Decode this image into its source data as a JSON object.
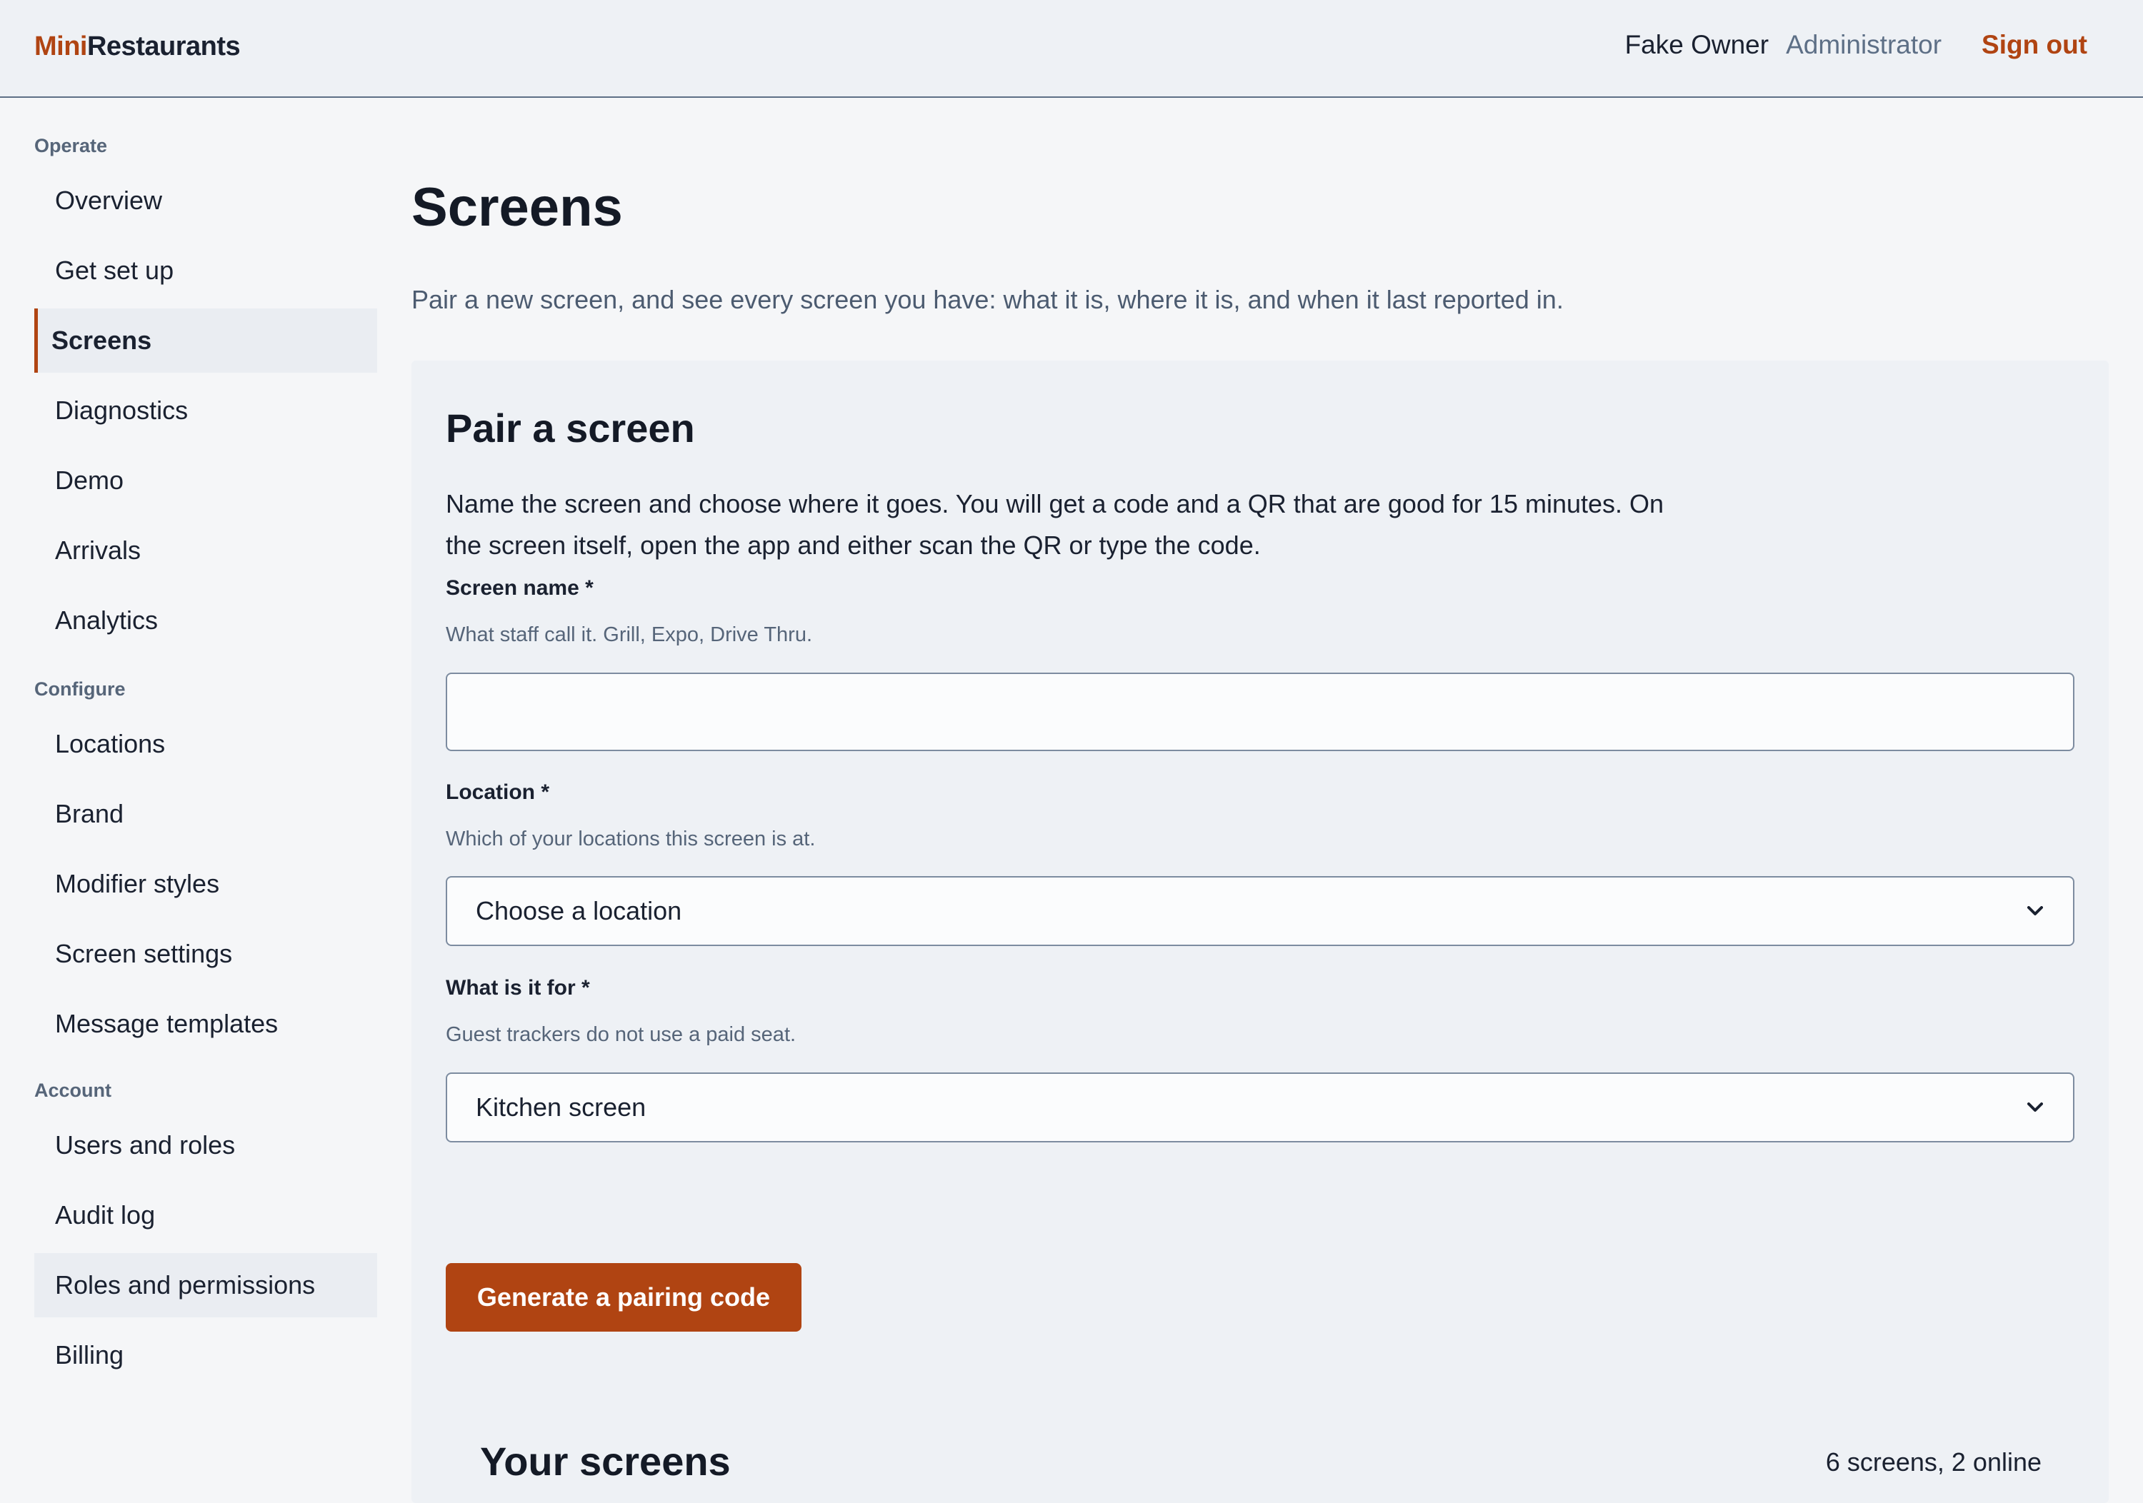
{
  "header": {
    "brand_accent": "Mini",
    "brand_rest": "Restaurants",
    "user_name": "Fake Owner",
    "user_role": "Administrator",
    "signout_label": "Sign out"
  },
  "sidebar": {
    "sections": [
      {
        "label": "Operate",
        "items": [
          {
            "label": "Overview"
          },
          {
            "label": "Get set up"
          },
          {
            "label": "Screens"
          },
          {
            "label": "Diagnostics"
          },
          {
            "label": "Demo"
          },
          {
            "label": "Arrivals"
          },
          {
            "label": "Analytics"
          }
        ]
      },
      {
        "label": "Configure",
        "items": [
          {
            "label": "Locations"
          },
          {
            "label": "Brand"
          },
          {
            "label": "Modifier styles"
          },
          {
            "label": "Screen settings"
          },
          {
            "label": "Message templates"
          }
        ]
      },
      {
        "label": "Account",
        "items": [
          {
            "label": "Users and roles"
          },
          {
            "label": "Audit log"
          },
          {
            "label": "Roles and permissions"
          },
          {
            "label": "Billing"
          }
        ]
      }
    ],
    "active_item": "Screens",
    "hovered_item": "Roles and permissions"
  },
  "main": {
    "title": "Screens",
    "description": "Pair a new screen, and see every screen you have: what it is, where it is, and when it last reported in.",
    "pair": {
      "title": "Pair a screen",
      "intro": "Name the screen and choose where it goes. You will get a code and a QR that are good for 15 minutes. On the screen itself, open the app and either scan the QR or type the code.",
      "name_label": "Screen name *",
      "name_hint": "What staff call it. Grill, Expo, Drive Thru.",
      "name_value": "",
      "location_label": "Location *",
      "location_hint": "Which of your locations this screen is at.",
      "location_selected": "Choose a location",
      "purpose_label": "What is it for *",
      "purpose_hint": "Guest trackers do not use a paid seat.",
      "purpose_selected": "Kitchen screen",
      "submit_label": "Generate a pairing code"
    },
    "screens": {
      "title": "Your screens",
      "summary": "6 screens, 2 online"
    }
  },
  "colors": {
    "accent": "#b04412",
    "muted_text": "#566579",
    "panel_bg": "#eef1f5"
  },
  "icons": {
    "select_chevron": "chevron-down-icon"
  }
}
